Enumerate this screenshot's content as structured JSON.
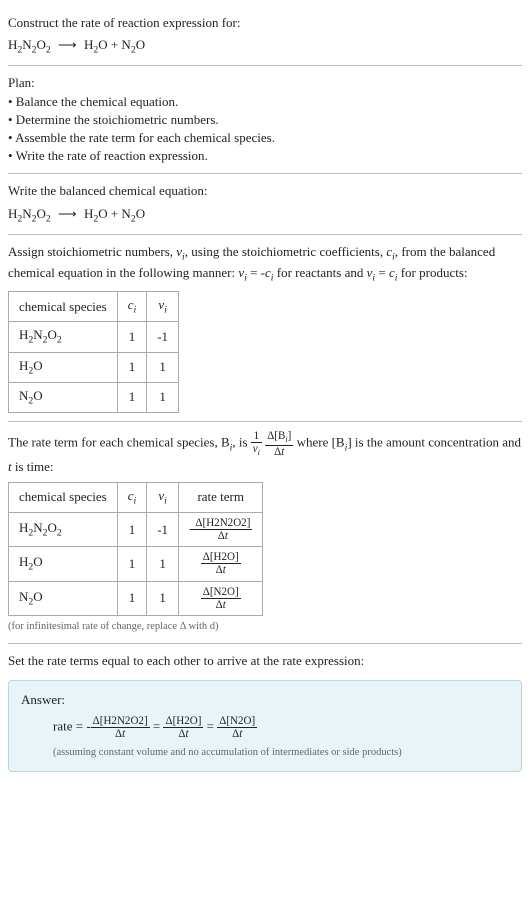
{
  "prompt": {
    "line1": "Construct the rate of reaction expression for:",
    "reaction_reactant": "H",
    "reaction_full_html": "H₂N₂O₂ ⟶ H₂O + N₂O"
  },
  "plan": {
    "heading": "Plan:",
    "items": [
      "• Balance the chemical equation.",
      "• Determine the stoichiometric numbers.",
      "• Assemble the rate term for each chemical species.",
      "• Write the rate of reaction expression."
    ]
  },
  "balance": {
    "heading": "Write the balanced chemical equation:"
  },
  "assign": {
    "text_before": "Assign stoichiometric numbers, ",
    "nu_var": "ν",
    "text_mid1": ", using the stoichiometric coefficients, ",
    "c_var": "c",
    "text_mid2": ", from the balanced chemical equation in the following manner: ",
    "eq1": "νᵢ = -cᵢ",
    "text_mid3": " for reactants and ",
    "eq2": "νᵢ = cᵢ",
    "text_mid4": " for products:",
    "table": {
      "headers": [
        "chemical species",
        "cᵢ",
        "νᵢ"
      ],
      "rows": [
        {
          "species": "H₂N₂O₂",
          "c": "1",
          "nu": "-1"
        },
        {
          "species": "H₂O",
          "c": "1",
          "nu": "1"
        },
        {
          "species": "N₂O",
          "c": "1",
          "nu": "1"
        }
      ]
    }
  },
  "rateterm": {
    "text1": "The rate term for each chemical species, B",
    "text2": ", is ",
    "frac1_num": "1",
    "frac1_den": "νᵢ",
    "frac2_num": "Δ[Bᵢ]",
    "frac2_den": "Δt",
    "text3": " where [B",
    "text4": "] is the amount concentration and ",
    "t_var": "t",
    "text5": " is time:",
    "table": {
      "headers": [
        "chemical species",
        "cᵢ",
        "νᵢ",
        "rate term"
      ],
      "rows": [
        {
          "species": "H₂N₂O₂",
          "c": "1",
          "nu": "-1",
          "term_sign": "-",
          "term_num": "Δ[H2N2O2]",
          "term_den": "Δt"
        },
        {
          "species": "H₂O",
          "c": "1",
          "nu": "1",
          "term_sign": "",
          "term_num": "Δ[H2O]",
          "term_den": "Δt"
        },
        {
          "species": "N₂O",
          "c": "1",
          "nu": "1",
          "term_sign": "",
          "term_num": "Δ[N2O]",
          "term_den": "Δt"
        }
      ]
    },
    "note": "(for infinitesimal rate of change, replace Δ with d)"
  },
  "final": {
    "heading": "Set the rate terms equal to each other to arrive at the rate expression:"
  },
  "answer": {
    "label": "Answer:",
    "prefix": "rate = ",
    "sign1": "-",
    "num1": "Δ[H2N2O2]",
    "den1": "Δt",
    "eq": " = ",
    "num2": "Δ[H2O]",
    "den2": "Δt",
    "num3": "Δ[N2O]",
    "den3": "Δt",
    "note": "(assuming constant volume and no accumulation of intermediates or side products)"
  }
}
